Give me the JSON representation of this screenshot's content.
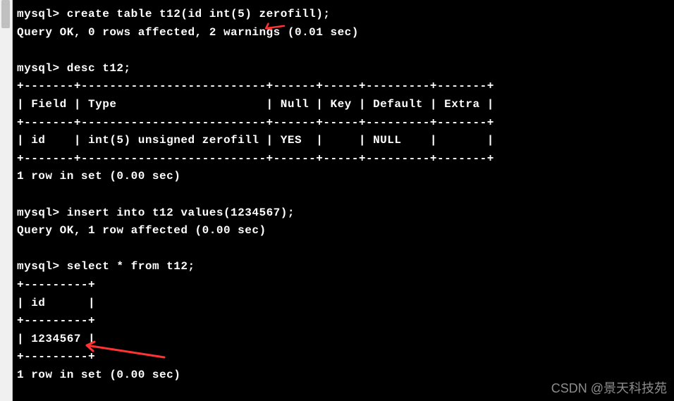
{
  "prompt": "mysql>",
  "lines": {
    "l1_cmd": "create table t12(id int(5) zerofill);",
    "l2": "Query OK, 0 rows affected, 2 warnings (0.01 sec)",
    "l3_cmd": "desc t12;",
    "l4": "+-------+--------------------------+------+-----+---------+-------+",
    "l5": "| Field | Type                     | Null | Key | Default | Extra |",
    "l6": "+-------+--------------------------+------+-----+---------+-------+",
    "l7": "| id    | int(5) unsigned zerofill | YES  |     | NULL    |       |",
    "l8": "+-------+--------------------------+------+-----+---------+-------+",
    "l9": "1 row in set (0.00 sec)",
    "l10_cmd": "insert into t12 values(1234567);",
    "l11": "Query OK, 1 row affected (0.00 sec)",
    "l12_cmd": "select * from t12;",
    "l13": "+---------+",
    "l14": "| id      |",
    "l15": "+---------+",
    "l16": "| 1234567 |",
    "l17": "+---------+",
    "l18": "1 row in set (0.00 sec)"
  },
  "watermark": "CSDN @景天科技苑",
  "arrow_color": "#ff3333"
}
